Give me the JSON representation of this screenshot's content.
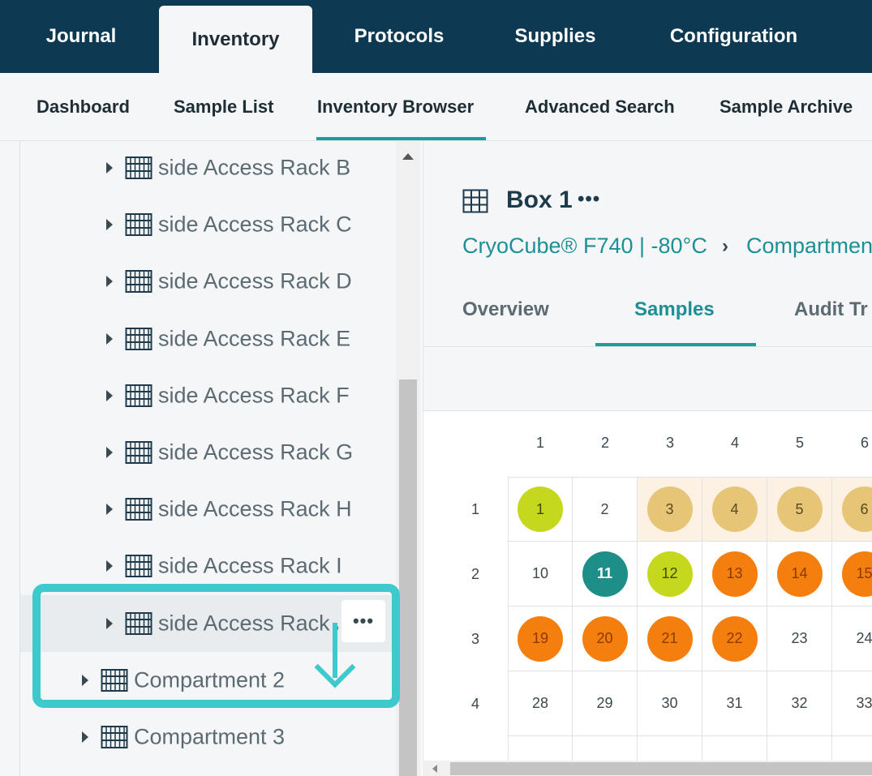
{
  "top_nav": {
    "tabs": [
      {
        "label": "Journal",
        "active": false
      },
      {
        "label": "Inventory",
        "active": true
      },
      {
        "label": "Protocols",
        "active": false
      },
      {
        "label": "Supplies",
        "active": false
      },
      {
        "label": "Configuration",
        "active": false
      }
    ]
  },
  "sub_nav": {
    "items": [
      {
        "label": "Dashboard",
        "active": false
      },
      {
        "label": "Sample List",
        "active": false
      },
      {
        "label": "Inventory Browser",
        "active": true
      },
      {
        "label": "Advanced Search",
        "active": false
      },
      {
        "label": "Sample Archive",
        "active": false
      }
    ]
  },
  "tree": {
    "items": [
      {
        "label": "side Access Rack B",
        "level": 2,
        "icon": "rack-icon"
      },
      {
        "label": "side Access Rack C",
        "level": 2,
        "icon": "rack-icon"
      },
      {
        "label": "side Access Rack D",
        "level": 2,
        "icon": "rack-icon"
      },
      {
        "label": "side Access Rack E",
        "level": 2,
        "icon": "rack-icon"
      },
      {
        "label": "side Access Rack F",
        "level": 2,
        "icon": "rack-icon"
      },
      {
        "label": "side Access Rack G",
        "level": 2,
        "icon": "rack-icon"
      },
      {
        "label": "side Access Rack H",
        "level": 2,
        "icon": "rack-icon"
      },
      {
        "label": "side Access Rack I",
        "level": 2,
        "icon": "rack-icon"
      },
      {
        "label": "side Access Rack J",
        "level": 2,
        "icon": "rack-icon",
        "hovered": true
      },
      {
        "label": "Compartment 2",
        "level": 1,
        "icon": "rack-icon"
      },
      {
        "label": "Compartment 3",
        "level": 1,
        "icon": "rack-icon"
      }
    ],
    "more_label": "•••"
  },
  "panel": {
    "title": "Box 1",
    "title_more": "•••",
    "breadcrumb": [
      "CryoCube® F740 | -80°C",
      "Compartment"
    ],
    "breadcrumb_separator": "›",
    "tabs": [
      {
        "label": "Overview",
        "active": false
      },
      {
        "label": "Samples",
        "active": true
      },
      {
        "label": "Audit Tr",
        "active": false
      }
    ]
  },
  "grid": {
    "col_headers": [
      "1",
      "2",
      "3",
      "4",
      "5",
      "6"
    ],
    "row_headers": [
      "1",
      "2",
      "3",
      "4"
    ],
    "rows": [
      [
        {
          "v": "1",
          "s": "lime"
        },
        {
          "v": "2",
          "s": "empty"
        },
        {
          "v": "3",
          "s": "tan",
          "shade": true
        },
        {
          "v": "4",
          "s": "tan",
          "shade": true
        },
        {
          "v": "5",
          "s": "tan",
          "shade": true
        },
        {
          "v": "6",
          "s": "tan",
          "shade": true
        }
      ],
      [
        {
          "v": "10",
          "s": "empty"
        },
        {
          "v": "11",
          "s": "teal"
        },
        {
          "v": "12",
          "s": "lime"
        },
        {
          "v": "13",
          "s": "orange"
        },
        {
          "v": "14",
          "s": "orange"
        },
        {
          "v": "15",
          "s": "orange"
        }
      ],
      [
        {
          "v": "19",
          "s": "orange"
        },
        {
          "v": "20",
          "s": "orange"
        },
        {
          "v": "21",
          "s": "orange"
        },
        {
          "v": "22",
          "s": "orange"
        },
        {
          "v": "23",
          "s": "empty"
        },
        {
          "v": "24",
          "s": "empty"
        }
      ],
      [
        {
          "v": "28",
          "s": "empty"
        },
        {
          "v": "29",
          "s": "empty"
        },
        {
          "v": "30",
          "s": "empty"
        },
        {
          "v": "31",
          "s": "empty"
        },
        {
          "v": "32",
          "s": "empty"
        },
        {
          "v": "33",
          "s": "empty"
        }
      ],
      [
        {
          "v": "",
          "s": "empty"
        },
        {
          "v": "",
          "s": "empty"
        },
        {
          "v": "",
          "s": "empty"
        },
        {
          "v": "",
          "s": "empty"
        },
        {
          "v": "",
          "s": "empty"
        },
        {
          "v": "",
          "s": "empty"
        }
      ]
    ]
  },
  "colors": {
    "nav_bg": "#0d3a52",
    "accent": "#1e9e9a",
    "highlight": "#3ec9cc",
    "lime": "#c5d81d",
    "teal": "#1e8f88",
    "tan": "#e6c577",
    "orange": "#f57f0e"
  }
}
